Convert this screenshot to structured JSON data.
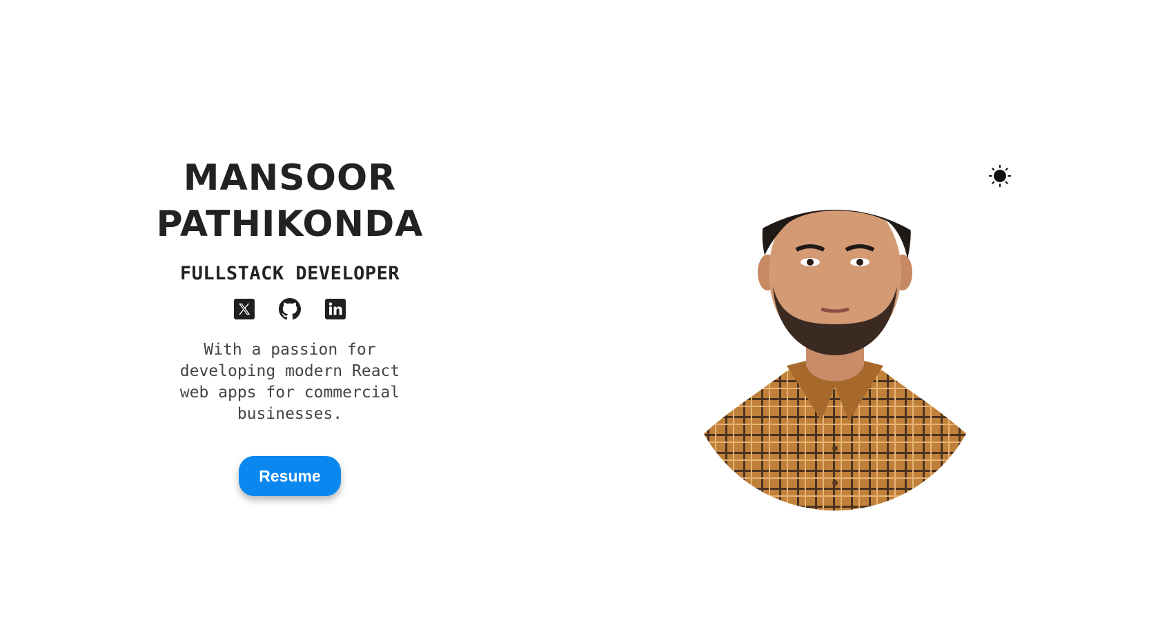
{
  "profile": {
    "name_line1": "MANSOOR",
    "name_line2": "PATHIKONDA",
    "role": "FULLSTACK DEVELOPER",
    "tagline": "With a passion for developing modern React web apps for commercial businesses.",
    "resume_label": "Resume"
  },
  "socials": [
    {
      "icon": "x-twitter-icon"
    },
    {
      "icon": "github-icon"
    },
    {
      "icon": "linkedin-icon"
    }
  ],
  "theme_toggle": {
    "icon": "sun-icon"
  },
  "portrait": {
    "icon": "profile-photo"
  },
  "colors": {
    "accent": "#0b87f0",
    "text": "#222222",
    "background": "#ffffff"
  }
}
